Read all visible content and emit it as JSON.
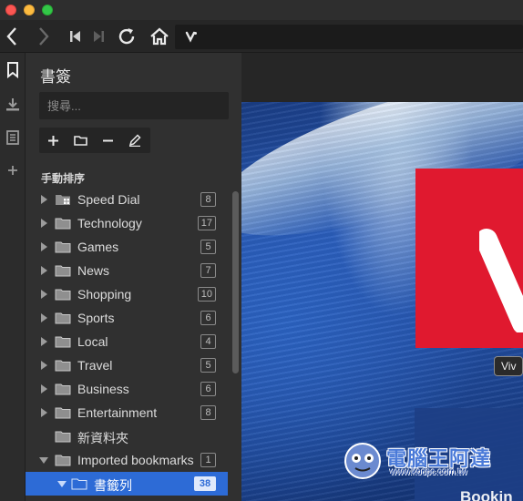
{
  "colors": {
    "accent": "#2d6bd6",
    "vivaldi_red": "#e0192f",
    "panel_bg": "#303030",
    "toolbar_bg": "#262626"
  },
  "window": {
    "traffic_lights": [
      "close",
      "minimize",
      "zoom"
    ]
  },
  "toolbar": {
    "buttons": [
      "back-icon",
      "forward-icon",
      "rewind-icon",
      "fast-forward-icon",
      "reload-icon",
      "home-icon"
    ],
    "address_icon": "vivaldi-logo-icon"
  },
  "side_strip": {
    "icons": [
      "bookmark-icon",
      "download-icon",
      "notes-icon",
      "add-icon"
    ]
  },
  "bookmarks": {
    "title": "書簽",
    "search_placeholder": "搜尋...",
    "actions": [
      "add-icon",
      "new-folder-icon",
      "remove-icon",
      "edit-icon"
    ],
    "sort_label": "手動排序",
    "items": [
      {
        "label": "Speed Dial",
        "count": "8",
        "icon": "speed-dial-folder-icon",
        "expanded": false
      },
      {
        "label": "Technology",
        "count": "17",
        "icon": "folder-icon",
        "expanded": false
      },
      {
        "label": "Games",
        "count": "5",
        "icon": "folder-icon",
        "expanded": false
      },
      {
        "label": "News",
        "count": "7",
        "icon": "folder-icon",
        "expanded": false
      },
      {
        "label": "Shopping",
        "count": "10",
        "icon": "folder-icon",
        "expanded": false
      },
      {
        "label": "Sports",
        "count": "6",
        "icon": "folder-icon",
        "expanded": false
      },
      {
        "label": "Local",
        "count": "4",
        "icon": "folder-icon",
        "expanded": false
      },
      {
        "label": "Travel",
        "count": "5",
        "icon": "folder-icon",
        "expanded": false
      },
      {
        "label": "Business",
        "count": "6",
        "icon": "folder-icon",
        "expanded": false
      },
      {
        "label": "Entertainment",
        "count": "8",
        "icon": "folder-icon",
        "expanded": false
      },
      {
        "label": "新資料夾",
        "count": "",
        "icon": "folder-icon",
        "expanded": false
      },
      {
        "label": "Imported bookmarks",
        "count": "1",
        "icon": "folder-icon",
        "expanded": true
      },
      {
        "label": "書籤列",
        "count": "38",
        "icon": "folder-icon",
        "expanded": true,
        "selected": true
      }
    ]
  },
  "content": {
    "tooltip": "Viv",
    "booking_text": "Bookin"
  },
  "watermark": {
    "title": "電腦王阿達",
    "url": "www.kocpc.com.tw"
  }
}
